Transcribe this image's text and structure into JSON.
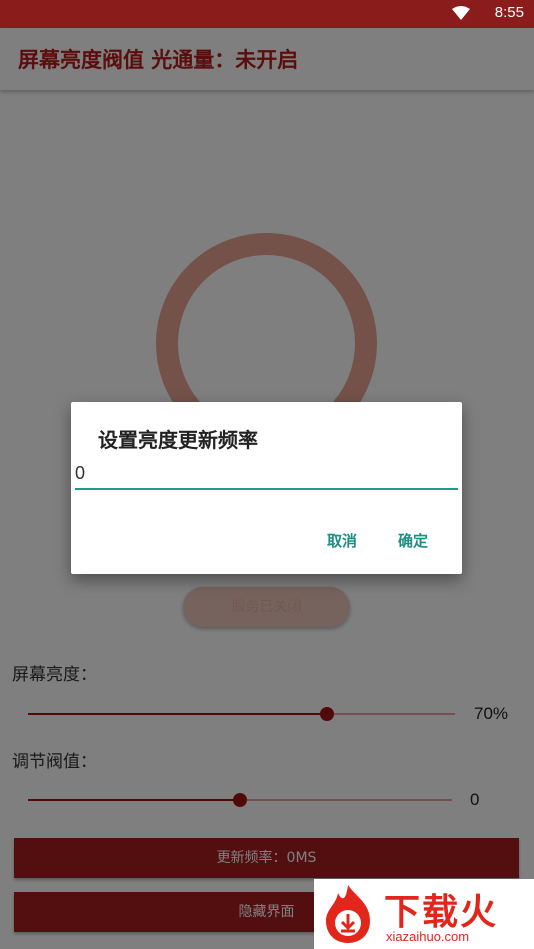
{
  "status_bar": {
    "time": "8:55",
    "wifi_icon": "wifi-icon"
  },
  "app_bar": {
    "title": "屏幕亮度阀值 光通量：未开启"
  },
  "main": {
    "service_button_label": "服务已关闭",
    "brightness": {
      "label": "屏幕亮度：",
      "value_text": "70%",
      "level": 0.7
    },
    "threshold": {
      "label": "调节阀值：",
      "value_text": "0",
      "level": 0.5
    },
    "update_rate_button": "更新频率：0MS",
    "hide_ui_button": "隐藏界面"
  },
  "dialog": {
    "title": "设置亮度更新频率",
    "input_value": "0",
    "cancel_label": "取消",
    "confirm_label": "确定"
  },
  "watermark": {
    "brand": "下载火",
    "url": "xiazaihuo.com"
  },
  "colors": {
    "brand_red": "#a61f1f",
    "accent_teal": "#1a8f82"
  }
}
